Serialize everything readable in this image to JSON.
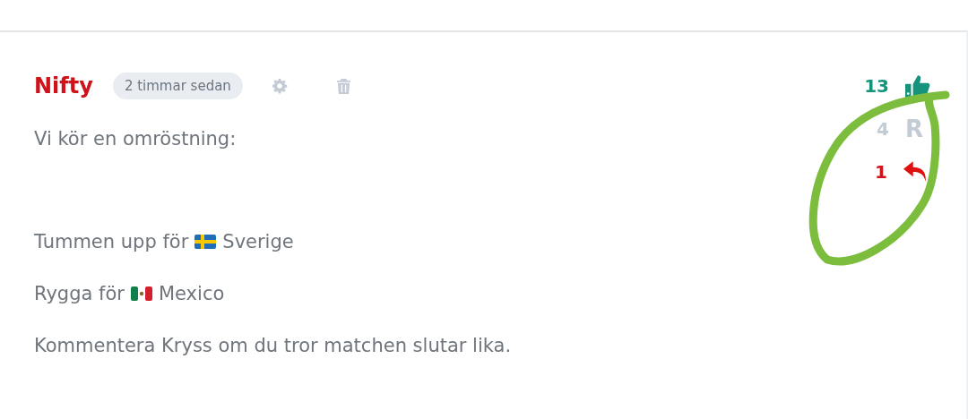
{
  "comment": {
    "author": "Nifty",
    "time": "2 timmar sedan",
    "lines": [
      {
        "kind": "text",
        "text": "Vi kör en omröstning:"
      },
      {
        "kind": "blank"
      },
      {
        "kind": "sweden",
        "before": "Tummen upp för",
        "after": "Sverige"
      },
      {
        "kind": "mexico",
        "before": "Rygga för",
        "after": "Mexico"
      },
      {
        "kind": "text",
        "text": "Kommentera Kryss om du tror matchen slutar lika."
      }
    ],
    "counters": [
      {
        "kind": "like",
        "count": "13"
      },
      {
        "kind": "letter",
        "count": "4",
        "label": "R"
      },
      {
        "kind": "reply",
        "count": "1"
      }
    ]
  }
}
